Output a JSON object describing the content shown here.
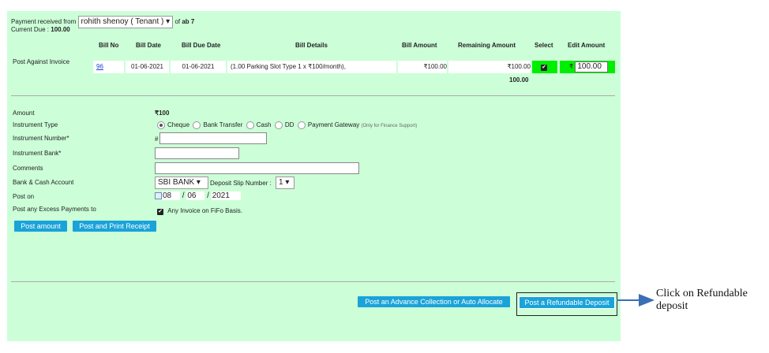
{
  "header": {
    "received_from_label": "Payment received from",
    "tenant_select": "rohith shenoy ( Tenant )",
    "of_label": "of",
    "unit": "ab 7",
    "current_due_label": "Current Due :",
    "current_due_value": "100.00"
  },
  "table": {
    "row_label": "Post Against Invoice",
    "columns": [
      "Bill No",
      "Bill Date",
      "Bill Due Date",
      "Bill Details",
      "Bill Amount",
      "Remaining Amount",
      "Select",
      "Edit Amount"
    ],
    "row": {
      "bill_no": "96",
      "bill_date": "01-06-2021",
      "bill_due_date": "01-06-2021",
      "bill_details": "(1.00 Parking Slot Type 1 x ₹100/month),",
      "bill_amount": "₹100.00",
      "remaining_amount": "₹100.00",
      "edit_currency": "₹",
      "edit_amount": "100.00"
    },
    "total": "100.00"
  },
  "form": {
    "amount_label": "Amount",
    "amount_value": "₹100",
    "instrument_type_label": "Instrument Type",
    "instrument_options": [
      "Cheque",
      "Bank Transfer",
      "Cash",
      "DD",
      "Payment Gateway"
    ],
    "payment_gateway_note": "(Only for Finance Support)",
    "instrument_number_label": "Instrument Number*",
    "instrument_number_prefix": "#",
    "instrument_bank_label": "Instrument Bank*",
    "comments_label": "Comments",
    "bank_account_label": "Bank & Cash Account",
    "bank_account_value": "SBI BANK",
    "deposit_slip_label": "Deposit Slip Number :",
    "deposit_slip_value": "1",
    "post_on_label": "Post on",
    "post_day": "08",
    "post_month": "06",
    "post_year": "2021",
    "date_sep": "/",
    "excess_label": "Post any Excess Payments to",
    "excess_option": "Any Invoice on FiFo Basis."
  },
  "buttons": {
    "post_amount": "Post amount",
    "post_print": "Post and Print Receipt",
    "advance": "Post an Advance Collection or Auto Allocate",
    "refundable": "Post a Refundable Deposit"
  },
  "annotation": {
    "text_line1": "Click  on Refundable",
    "text_line2": "deposit"
  },
  "colors": {
    "panel_bg": "#ccffd8",
    "button_bg": "#1aa3d9",
    "edit_amount_highlight": "#00ee00",
    "arrow": "#3a6fb5"
  }
}
